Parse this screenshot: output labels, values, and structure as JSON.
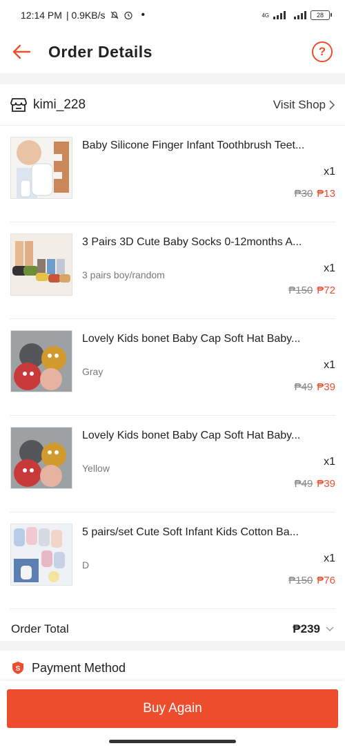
{
  "status_bar": {
    "time": "12:14 PM",
    "speed": "| 0.9KB/s",
    "network": "4G",
    "battery": "28"
  },
  "header": {
    "title": "Order Details",
    "back_icon": "arrow-left-icon",
    "help_icon": "question-circle-icon",
    "help_glyph": "?"
  },
  "shop": {
    "name": "kimi_228",
    "visit_label": "Visit Shop"
  },
  "items": [
    {
      "name": "Baby Silicone Finger Infant Toothbrush Teet...",
      "variant": "",
      "qty": "x1",
      "old_price": "₱30",
      "new_price": "₱13"
    },
    {
      "name": "3 Pairs 3D Cute Baby Socks  0-12months A...",
      "variant": "3 pairs boy/random",
      "qty": "x1",
      "old_price": "₱150",
      "new_price": "₱72"
    },
    {
      "name": "Lovely Kids bonet Baby Cap Soft Hat Baby...",
      "variant": "Gray",
      "qty": "x1",
      "old_price": "₱49",
      "new_price": "₱39"
    },
    {
      "name": "Lovely Kids bonet Baby Cap Soft Hat Baby...",
      "variant": "Yellow",
      "qty": "x1",
      "old_price": "₱49",
      "new_price": "₱39"
    },
    {
      "name": "5 pairs/set Cute Soft Infant Kids Cotton Ba...",
      "variant": "D",
      "qty": "x1",
      "old_price": "₱150",
      "new_price": "₱76"
    }
  ],
  "order_total": {
    "label": "Order Total",
    "value": "₱239"
  },
  "payment": {
    "label": "Payment Method"
  },
  "actions": {
    "buy_again": "Buy Again"
  },
  "colors": {
    "accent": "#ee4d2d"
  }
}
